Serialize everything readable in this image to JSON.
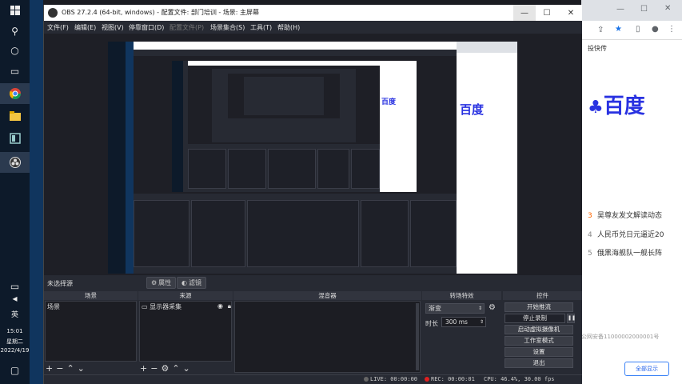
{
  "taskbar": {
    "ime": "英",
    "time": "15:01",
    "weekday": "星期二",
    "date": "2022/4/19"
  },
  "obs": {
    "title": "OBS 27.2.4 (64-bit, windows) - 配置文件: 部门培训 - 场景: 主屏幕",
    "menu": [
      "文件(F)",
      "编辑(E)",
      "视图(V)",
      "停靠窗口(D)",
      "配置文件(P)",
      "场景集合(S)",
      "工具(T)",
      "帮助(H)"
    ],
    "selection_label": "未选择源",
    "properties_label": "属性",
    "filters_label": "滤镜",
    "docks": {
      "scenes": {
        "title": "场景",
        "items": [
          "场景"
        ]
      },
      "sources": {
        "title": "来源",
        "items": [
          "显示器采集"
        ]
      },
      "mixer": {
        "title": "混音器"
      },
      "transitions": {
        "title": "转场特效",
        "type": "渐变",
        "duration_label": "时长",
        "duration_value": "300 ms"
      },
      "controls": {
        "title": "控件",
        "buttons": [
          "开始推流",
          "停止录制",
          "启动虚拟摄像机",
          "工作室模式",
          "设置",
          "退出"
        ]
      }
    },
    "status": {
      "live": "LIVE: 00:00:00",
      "rec": "REC: 00:00:01",
      "cpu": "CPU: 46.4%, 30.00 fps"
    }
  },
  "browser": {
    "shortcut_label": "投快传",
    "logo": "百度",
    "hot_list": [
      {
        "rank": "3",
        "text": "吴尊友发文解读动态"
      },
      {
        "rank": "4",
        "text": "人民币兑日元逼近20"
      },
      {
        "rank": "5",
        "text": "俄黑海舰队一舰长阵"
      }
    ],
    "footer": "公网安备11000002000001号",
    "show_all": "全部显示"
  },
  "colors": {
    "obs_bg": "#272a33",
    "taskbar_bg": "#0d1a2a",
    "baidu_blue": "#2932e1",
    "rec_red": "#e02020"
  }
}
